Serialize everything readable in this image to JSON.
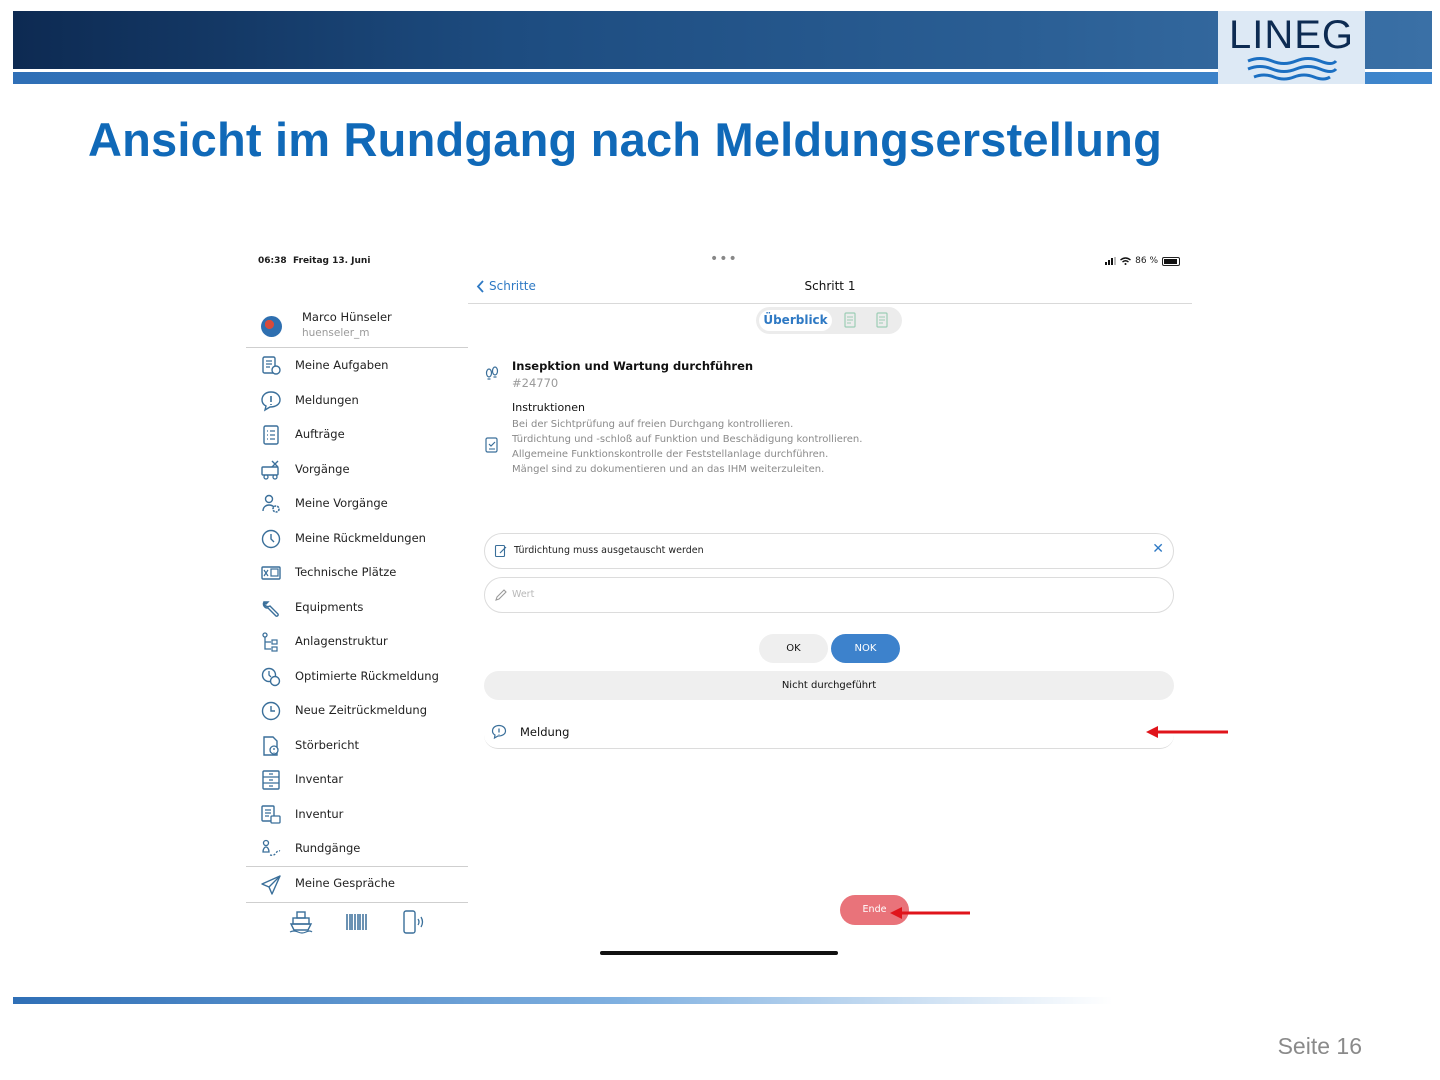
{
  "slide": {
    "title": "Ansicht im Rundgang nach Meldungserstellung",
    "logo_text": "LINEG",
    "page_number": "Seite 16",
    "colors": {
      "title": "#1069b8",
      "banner": "#1d4c80",
      "accent": "#2e79c4",
      "end_button": "#e9737a",
      "annotation_arrow": "#e0141b"
    }
  },
  "status_bar": {
    "time": "06:38",
    "date": "Freitag 13. Juni",
    "dots": "•••",
    "battery": "86 %"
  },
  "sidebar": {
    "user": {
      "name": "Marco Hünseler",
      "username": "huenseler_m"
    },
    "items": [
      {
        "label": "Meine Aufgaben",
        "icon": "tasks-icon"
      },
      {
        "label": "Meldungen",
        "icon": "speech-bubble-exclamation-icon"
      },
      {
        "label": "Aufträge",
        "icon": "clipboard-list-icon"
      },
      {
        "label": "Vorgänge",
        "icon": "truck-tools-icon"
      },
      {
        "label": "Meine Vorgänge",
        "icon": "person-gear-icon"
      },
      {
        "label": "Meine Rückmeldungen",
        "icon": "clock-icon"
      },
      {
        "label": "Technische Plätze",
        "icon": "machine-location-icon"
      },
      {
        "label": "Equipments",
        "icon": "wrench-icon"
      },
      {
        "label": "Anlagenstruktur",
        "icon": "tree-structure-icon"
      },
      {
        "label": "Optimierte Rückmeldung",
        "icon": "clock-refresh-icon"
      },
      {
        "label": "Neue Zeitrückmeldung",
        "icon": "clock-plus-icon"
      },
      {
        "label": "Störbericht",
        "icon": "document-alert-icon"
      },
      {
        "label": "Inventar",
        "icon": "cabinet-icon"
      },
      {
        "label": "Inventur",
        "icon": "inventory-list-icon"
      },
      {
        "label": "Rundgänge",
        "icon": "walking-route-icon"
      },
      {
        "label": "Meine Gespräche",
        "icon": "paper-plane-icon"
      }
    ],
    "bottom_icons": [
      "ship-icon",
      "barcode-icon",
      "nfc-phone-icon"
    ]
  },
  "nav": {
    "back_label": "Schritte",
    "title": "Schritt 1"
  },
  "segment": {
    "active_label": "Überblick",
    "other_icons": [
      "document-icon",
      "document-icon"
    ]
  },
  "task": {
    "title": "Insepktion und Wartung durchführen",
    "id": "#24770",
    "instructions_heading": "Instruktionen",
    "instructions": [
      "Bei der Sichtprüfung auf freien Durchgang kontrollieren.",
      "Türdichtung und -schloß auf Funktion und Beschädigung kontrollieren.",
      "Allgemeine Funktionskontrolle der Feststellanlage durchführen.",
      "Mängel sind zu dokumentieren und an das IHM weiterzuleiten."
    ]
  },
  "form": {
    "note_value": "Türdichtung muss ausgetauscht werden",
    "value_placeholder": "Wert",
    "ok_label": "OK",
    "nok_label": "NOK",
    "not_done_label": "Nicht durchgeführt",
    "meldung_label": "Meldung",
    "end_label": "Ende"
  }
}
